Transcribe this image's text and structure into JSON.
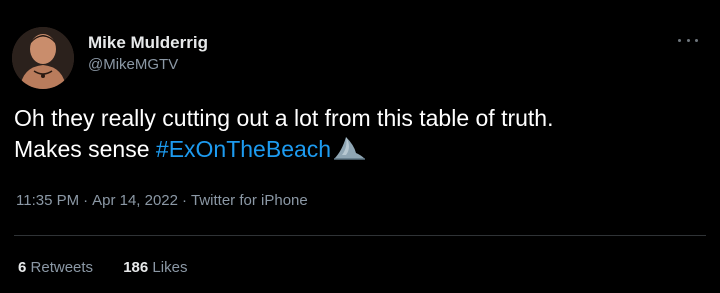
{
  "author": {
    "display_name": "Mike Mulderrig",
    "handle": "@MikeMGTV"
  },
  "tweet": {
    "line1": "Oh they really cutting out a lot from this table of truth.",
    "line2_prefix": "Makes sense",
    "hashtag": "#ExOnTheBeach",
    "emoji": "shark-emoji"
  },
  "meta": {
    "time": "11:35 PM",
    "separator": "·",
    "date": "Apr 14, 2022",
    "source": "Twitter for iPhone"
  },
  "stats": {
    "retweets_count": "6",
    "retweets_label": "Retweets",
    "likes_count": "186",
    "likes_label": "Likes"
  },
  "colors": {
    "background": "#000000",
    "text": "#e7e9ea",
    "secondary": "#8b98a5",
    "link": "#1d9bf0"
  }
}
